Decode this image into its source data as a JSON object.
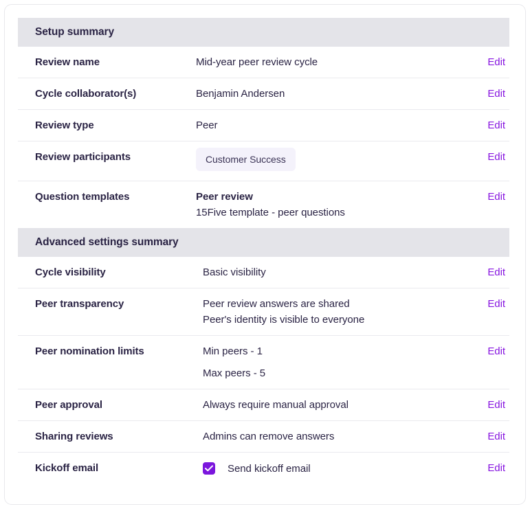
{
  "card": {
    "sections": [
      {
        "id": "setup",
        "title": "Setup summary",
        "rows": [
          {
            "label": "Review name",
            "values": [
              {
                "text": "Mid-year peer review cycle",
                "bold": false
              }
            ],
            "edit": "Edit"
          },
          {
            "label": "Cycle collaborator(s)",
            "values": [
              {
                "text": "Benjamin Andersen",
                "bold": false
              }
            ],
            "edit": "Edit"
          },
          {
            "label": "Review type",
            "values": [
              {
                "text": "Peer",
                "bold": false
              }
            ],
            "edit": "Edit"
          },
          {
            "label": "Review participants",
            "chip": "Customer Success",
            "edit": "Edit"
          },
          {
            "label": "Question templates",
            "values": [
              {
                "text": "Peer review",
                "bold": true
              },
              {
                "text": "15Five template - peer questions",
                "bold": false
              }
            ],
            "edit": "Edit"
          }
        ]
      },
      {
        "id": "advanced",
        "title": "Advanced settings summary",
        "rows": [
          {
            "label": "Cycle visibility",
            "values": [
              {
                "text": "Basic visibility",
                "bold": false
              }
            ],
            "edit": "Edit"
          },
          {
            "label": "Peer transparency",
            "values": [
              {
                "text": "Peer review answers are shared",
                "bold": false
              },
              {
                "text": "Peer's identity is visible to everyone",
                "bold": false
              }
            ],
            "edit": "Edit"
          },
          {
            "label": "Peer nomination limits",
            "values": [
              {
                "text": "Min peers - 1",
                "bold": false
              },
              {
                "text": "Max peers - 5",
                "bold": false
              }
            ],
            "edit": "Edit"
          },
          {
            "label": "Peer approval",
            "values": [
              {
                "text": "Always require manual approval",
                "bold": false
              }
            ],
            "edit": "Edit"
          },
          {
            "label": "Sharing reviews",
            "values": [
              {
                "text": "Admins can remove answers",
                "bold": false
              }
            ],
            "edit": "Edit"
          },
          {
            "label": "Kickoff email",
            "checkbox": {
              "checked": true,
              "label": "Send kickoff email",
              "icon": "check-icon"
            },
            "edit": "Edit"
          }
        ]
      }
    ]
  },
  "colors": {
    "accent_purple": "#8614e0",
    "checkbox_fill": "#7b16dd",
    "band_gray": "#e4e4e9",
    "text_navy": "#2a2344",
    "chip_bg": "#f4f2fb",
    "divider": "#eaeaee"
  }
}
